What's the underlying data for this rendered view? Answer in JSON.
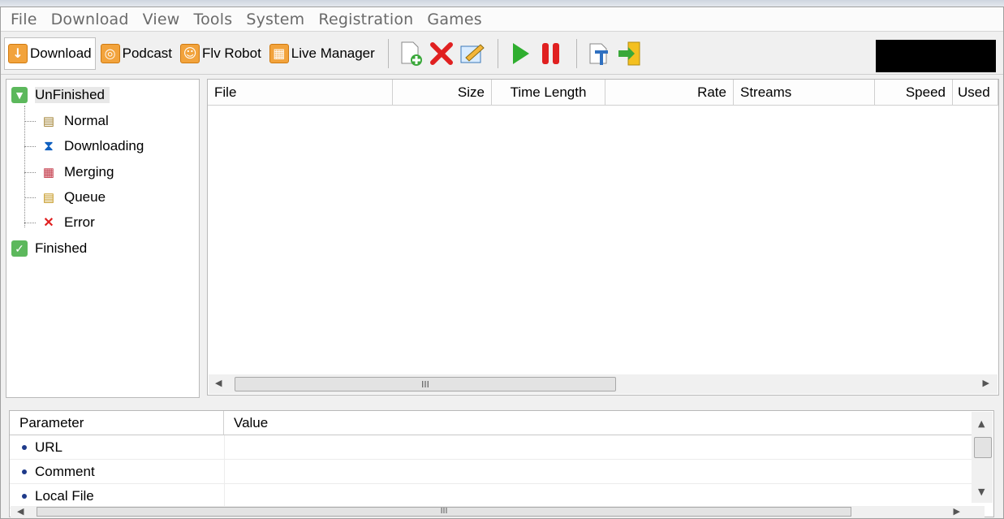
{
  "menu": [
    "File",
    "Download",
    "View",
    "Tools",
    "System",
    "Registration",
    "Games"
  ],
  "toolbar": {
    "buttons": [
      {
        "label": "Download",
        "icon": "download-icon"
      },
      {
        "label": "Podcast",
        "icon": "podcast-icon"
      },
      {
        "label": "Flv Robot",
        "icon": "robot-icon"
      },
      {
        "label": "Live Manager",
        "icon": "live-manager-icon"
      }
    ],
    "actions": [
      "new-task-icon",
      "delete-icon",
      "edit-icon",
      "start-icon",
      "pause-icon",
      "move-icon",
      "import-icon"
    ]
  },
  "tree": {
    "unfinished": "UnFinished",
    "children": [
      "Normal",
      "Downloading",
      "Merging",
      "Queue",
      "Error"
    ],
    "finished": "Finished"
  },
  "list": {
    "columns": [
      "File",
      "Size",
      "Time Length",
      "Rate",
      "Streams",
      "Speed",
      "Used"
    ],
    "scroll_grip": "III"
  },
  "params": {
    "col_parameter": "Parameter",
    "col_value": "Value",
    "rows": [
      "URL",
      "Comment",
      "Local File"
    ],
    "scroll_grip": "III"
  },
  "colors": {
    "accent_orange": "#f2a33c",
    "tree_green": "#5cb85c",
    "bullet_blue": "#1e3a8a"
  }
}
